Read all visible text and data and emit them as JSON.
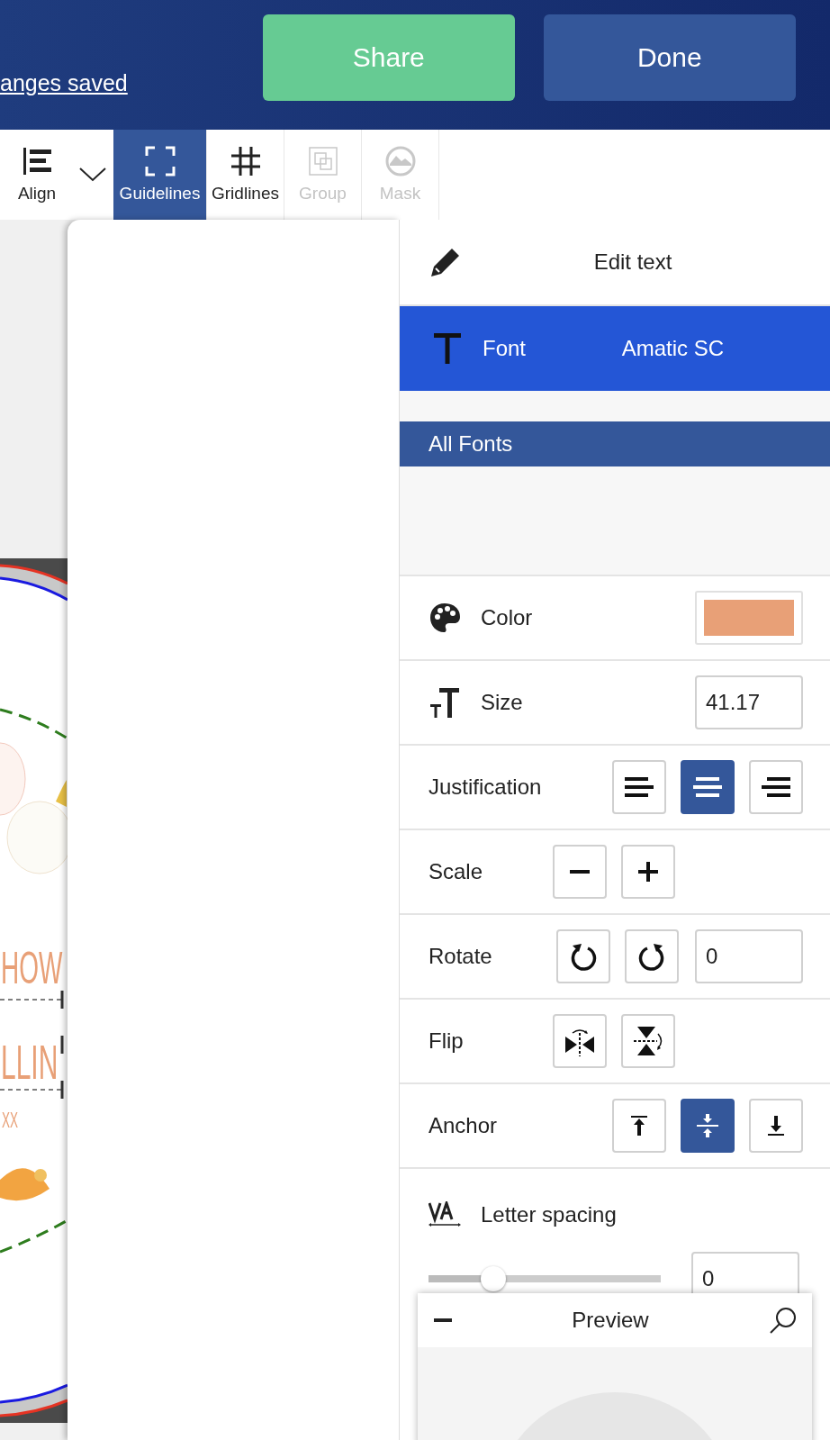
{
  "header": {
    "save_link": "anges saved",
    "buttons": [
      {
        "label": "Share",
        "kind": "share"
      },
      {
        "label": "Done",
        "kind": "done"
      }
    ]
  },
  "toolbar": [
    {
      "label": "Align",
      "kind": "align",
      "selected": false,
      "disabled": false
    },
    {
      "label": "Guidelines",
      "kind": "guidelines",
      "selected": true,
      "disabled": false
    },
    {
      "label": "Gridlines",
      "kind": "gridlines",
      "selected": false,
      "disabled": false
    },
    {
      "label": "Group",
      "kind": "group",
      "selected": false,
      "disabled": true
    },
    {
      "label": "Mask",
      "kind": "mask",
      "selected": false,
      "disabled": true
    }
  ],
  "canvas": {
    "texts": [
      "HOW",
      "LLIN",
      "XX"
    ]
  },
  "panel": {
    "edit_text": "Edit text",
    "font": {
      "label": "Font",
      "value": "Amatic SC"
    },
    "all_fonts": "All Fonts",
    "color": {
      "label": "Color",
      "color": "#e8a077"
    },
    "size": {
      "label": "Size",
      "value": "41.17"
    },
    "justification": {
      "label": "Justification",
      "options": [
        {
          "kind": "left",
          "selected": false
        },
        {
          "kind": "center",
          "selected": true
        },
        {
          "kind": "right",
          "selected": false
        }
      ]
    },
    "scale": {
      "label": "Scale"
    },
    "rotate": {
      "label": "Rotate",
      "value": "0"
    },
    "flip": {
      "label": "Flip"
    },
    "anchor": {
      "label": "Anchor",
      "options": [
        {
          "kind": "top",
          "selected": false
        },
        {
          "kind": "middle",
          "selected": true
        },
        {
          "kind": "bottom",
          "selected": false
        }
      ]
    },
    "letter_spacing": {
      "label": "Letter spacing",
      "level": 0.28,
      "value": "0"
    }
  },
  "preview": {
    "title": "Preview"
  }
}
